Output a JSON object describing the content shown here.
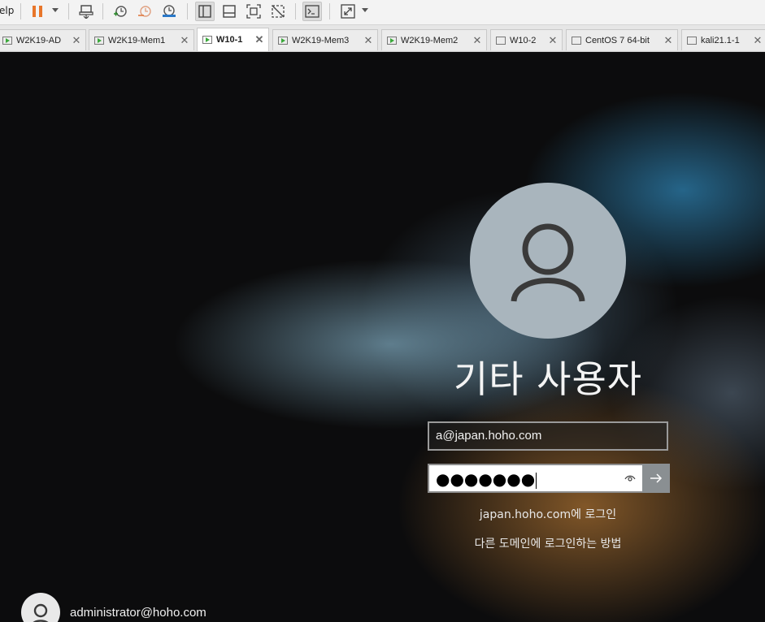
{
  "toolbar": {
    "menu_label": "elp",
    "icons": [
      "pause-icon",
      "send-ctrl-alt-del-icon",
      "snapshot-icon",
      "revert-snapshot-icon",
      "snapshot-manager-icon",
      "library-view-icon",
      "thumbnail-view-icon",
      "fullscreen-icon",
      "unity-icon",
      "console-view-icon",
      "stretch-icon"
    ]
  },
  "tabs": [
    {
      "label": "W2K19-AD",
      "running": true,
      "active": false
    },
    {
      "label": "W2K19-Mem1",
      "running": true,
      "active": false
    },
    {
      "label": "W10-1",
      "running": true,
      "active": true
    },
    {
      "label": "W2K19-Mem3",
      "running": true,
      "active": false
    },
    {
      "label": "W2K19-Mem2",
      "running": true,
      "active": false
    },
    {
      "label": "W10-2",
      "running": false,
      "active": false
    },
    {
      "label": "CentOS 7 64-bit",
      "running": false,
      "active": false
    },
    {
      "label": "kali21.1-1",
      "running": false,
      "active": false
    }
  ],
  "login": {
    "title": "기타 사용자",
    "username_value": "a@japan.hoho.com",
    "password_mask": "●●●●●●●",
    "signin_to": "japan.hoho.com에 로그인",
    "other_domain_link": "다른 도메인에 로그인하는 방법"
  },
  "other_user": {
    "name": "administrator@hoho.com"
  },
  "colors": {
    "accent_pause": "#e8762a",
    "active_tab_text": "#000000"
  }
}
